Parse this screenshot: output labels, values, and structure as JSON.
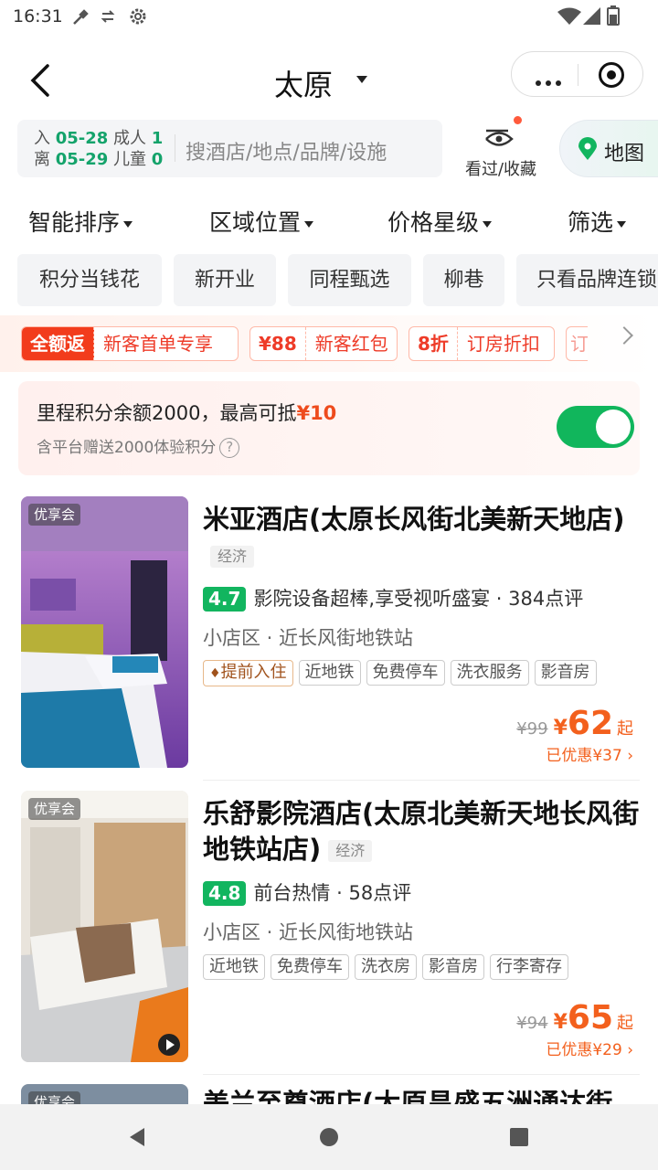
{
  "status": {
    "time": "16:31"
  },
  "header": {
    "city": "太原"
  },
  "search": {
    "checkin_label": "入",
    "checkin": "05-28",
    "checkout_label": "离",
    "checkout": "05-29",
    "adults_label": "成人",
    "adults": "1",
    "children_label": "儿童",
    "children": "0",
    "placeholder": "搜酒店/地点/品牌/设施",
    "viewed_label": "看过/收藏",
    "map_label": "地图"
  },
  "filters": [
    "智能排序",
    "区域位置",
    "价格星级",
    "筛选"
  ],
  "chips": [
    "积分当钱花",
    "新开业",
    "同程甄选",
    "柳巷",
    "只看品牌连锁"
  ],
  "coupons": [
    {
      "head": "全额返",
      "text": "新客首单专享"
    },
    {
      "head": "¥88",
      "text": "新客红包"
    },
    {
      "head": "8折",
      "text": "订房折扣"
    },
    {
      "head": "订",
      "text": ""
    }
  ],
  "points": {
    "main_prefix": "里程积分余额2000，最高可抵",
    "main_amount": "¥10",
    "sub": "含平台赠送2000体验积分",
    "help": "?",
    "enabled": true
  },
  "hotels": [
    {
      "badge": "优享会",
      "name": "米亚酒店(太原长风街北美新天地店)",
      "type": "经济",
      "score": "4.7",
      "highlight": "影院设备超棒,享受视听盛宴 · 384点评",
      "location": "小店区 · 近长风街地铁站",
      "tags": [
        "提前入住",
        "近地铁",
        "免费停车",
        "洗衣服务",
        "影音房"
      ],
      "orig_price": "¥99",
      "yen": "¥",
      "price": "62",
      "price_suffix": "起",
      "saved": "已优惠¥37"
    },
    {
      "badge": "优享会",
      "name": "乐舒影院酒店(太原北美新天地长风街地铁站店)",
      "type": "经济",
      "score": "4.8",
      "highlight": "前台热情 · 58点评",
      "location": "小店区 · 近长风街地铁站",
      "tags": [
        "近地铁",
        "免费停车",
        "洗衣房",
        "影音房",
        "行李寄存"
      ],
      "orig_price": "¥94",
      "yen": "¥",
      "price": "65",
      "price_suffix": "起",
      "saved": "已优惠¥29"
    },
    {
      "badge": "优享会",
      "name": "美兰至尊酒店(太原昌盛五洲通达街"
    }
  ],
  "colors": {
    "accent_green": "#12b55f",
    "price_orange": "#f3601d",
    "coupon_red": "#ee3b28"
  }
}
